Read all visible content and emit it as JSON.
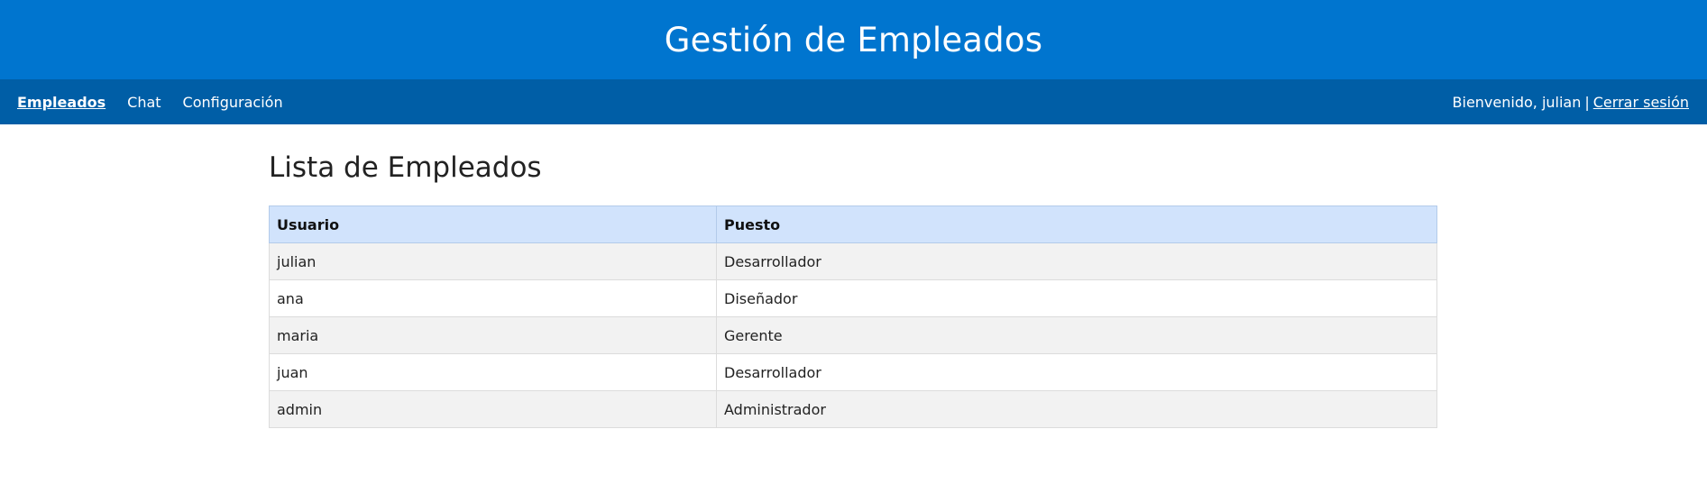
{
  "header": {
    "title": "Gestión de Empleados"
  },
  "nav": {
    "items": [
      {
        "label": "Empleados"
      },
      {
        "label": "Chat"
      },
      {
        "label": "Configuración"
      }
    ],
    "welcome": "Bienvenido, julian",
    "separator": "|",
    "logout_label": "Cerrar sesión"
  },
  "main": {
    "title": "Lista de Empleados",
    "table": {
      "headers": [
        "Usuario",
        "Puesto"
      ],
      "rows": [
        [
          "julian",
          "Desarrollador"
        ],
        [
          "ana",
          "Diseñador"
        ],
        [
          "maria",
          "Gerente"
        ],
        [
          "juan",
          "Desarrollador"
        ],
        [
          "admin",
          "Administrador"
        ]
      ]
    }
  },
  "colors": {
    "header_bg": "#0075cf",
    "nav_bg": "#005ea6",
    "table_header_bg": "#d1e3fc",
    "row_alt_bg": "#f2f2f2"
  }
}
